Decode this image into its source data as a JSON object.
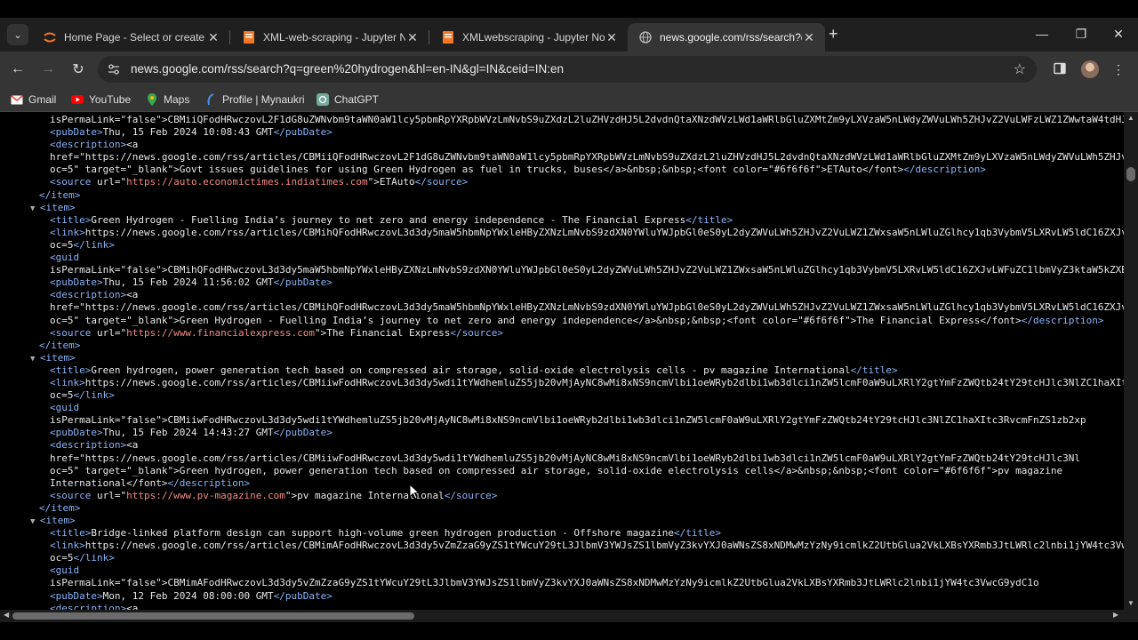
{
  "tabs": [
    {
      "title": "Home Page - Select or create a",
      "favicon": "jupyter-icon",
      "active": false
    },
    {
      "title": "XML-web-scraping - Jupyter Nc",
      "favicon": "jupyter-notebook-icon",
      "active": false
    },
    {
      "title": "XMLwebscraping - Jupyter Note",
      "favicon": "jupyter-notebook-icon",
      "active": false
    },
    {
      "title": "news.google.com/rss/search?q",
      "favicon": "globe-icon",
      "active": true
    }
  ],
  "address": {
    "url": "news.google.com/rss/search?q=green%20hydrogen&hl=en-IN&gl=IN&ceid=IN:en"
  },
  "bookmarks": [
    {
      "label": "Gmail",
      "icon": "gmail-icon"
    },
    {
      "label": "YouTube",
      "icon": "youtube-icon"
    },
    {
      "label": "Maps",
      "icon": "maps-icon"
    },
    {
      "label": "Profile | Mynaukri",
      "icon": "naukri-icon"
    },
    {
      "label": "ChatGPT",
      "icon": "chatgpt-icon"
    }
  ],
  "colors": {
    "tag": "#8ab4f8",
    "attr_value": "#f28b82",
    "text": "#e8e8e8",
    "background": "#000000"
  },
  "xml_lines": [
    {
      "indent": 2,
      "parts": [
        [
          "t",
          "isPermaLink=\"false\">CBMiiQFodHRwczovL2F1dG8uZWNvbm9taWN0aW1lcy5pbmRpYXRpbWVzLmNvbS9uZXdzL2luZHVzdHJ5L2dvdnQtaXNzdWVzLWd1aWRlbGluZXMtZm9yLXVzaW5nLWdyZWVuLWh5ZHJvZ2VuLWFzLWZ1ZWwtaW4tdHJ1Y2tz"
        ]
      ]
    },
    {
      "indent": 2,
      "parts": [
        [
          "g",
          "<pubDate>"
        ],
        [
          "t",
          "Thu, 15 Feb 2024 10:08:43 GMT"
        ],
        [
          "g",
          "</pubDate>"
        ]
      ]
    },
    {
      "indent": 2,
      "parts": [
        [
          "g",
          "<description>"
        ],
        [
          "t",
          "<a"
        ]
      ]
    },
    {
      "indent": 2,
      "parts": [
        [
          "t",
          "href=\"https://news.google.com/rss/articles/CBMiiQFodHRwczovL2F1dG8uZWNvbm9taWN0aW1lcy5pbmRpYXRpbWVzLmNvbS9uZXdzL2luZHVzdHJ5L2dvdnQtaXNzdWVzLWd1aWRlbGluZXMtZm9yLXVzaW5nLWdyZWVuLWh5ZHJv"
        ]
      ]
    },
    {
      "indent": 2,
      "parts": [
        [
          "t",
          "oc=5\" target=\"_blank\">Govt issues guidelines for using Green Hydrogen as fuel in trucks, buses</a>&nbsp;&nbsp;<font color=\"#6f6f6f\">ETAuto</font>"
        ],
        [
          "g",
          "</description>"
        ]
      ]
    },
    {
      "indent": 2,
      "parts": [
        [
          "g",
          "<source "
        ],
        [
          "t",
          "url=\""
        ],
        [
          "v",
          "https://auto.economictimes.indiatimes.com"
        ],
        [
          "t",
          "\">"
        ],
        [
          "t",
          "ETAuto"
        ],
        [
          "g",
          "</source>"
        ]
      ]
    },
    {
      "indent": 1,
      "parts": [
        [
          "g",
          "</item>"
        ]
      ]
    },
    {
      "indent": 0,
      "tri": true,
      "parts": [
        [
          "g",
          "<item>"
        ]
      ]
    },
    {
      "indent": 2,
      "parts": [
        [
          "g",
          "<title>"
        ],
        [
          "t",
          "Green Hydrogen - Fuelling India’s journey to net zero and energy independence - The Financial Express"
        ],
        [
          "g",
          "</title>"
        ]
      ]
    },
    {
      "indent": 2,
      "parts": [
        [
          "g",
          "<link>"
        ],
        [
          "t",
          "https://news.google.com/rss/articles/CBMihQFodHRwczovL3d3dy5maW5hbmNpYWxleHByZXNzLmNvbS9zdXN0YWluYWJpbGl0eS0yL2dyZWVuLWh5ZHJvZ2VuLWZ1ZWxsaW5nLWluZGlhcy1qb3VybmV5LXRvLW5ldC16ZXJvLWFuZC1lbmVyZ3kt"
        ]
      ]
    },
    {
      "indent": 2,
      "parts": [
        [
          "t",
          "oc=5"
        ],
        [
          "g",
          "</link>"
        ]
      ]
    },
    {
      "indent": 2,
      "parts": [
        [
          "g",
          "<guid"
        ]
      ]
    },
    {
      "indent": 2,
      "parts": [
        [
          "t",
          "isPermaLink=\"false\">CBMihQFodHRwczovL3d3dy5maW5hbmNpYWxleHByZXNzLmNvbS9zdXN0YWluYWJpbGl0eS0yL2dyZWVuLWh5ZHJvZ2VuLWZ1ZWxsaW5nLWluZGlhcy1qb3VybmV5LXRvLW5ldC16ZXJvLWFuZC1lbmVyZ3ktaW5kZXBl"
        ]
      ]
    },
    {
      "indent": 2,
      "parts": [
        [
          "g",
          "<pubDate>"
        ],
        [
          "t",
          "Thu, 15 Feb 2024 11:56:02 GMT"
        ],
        [
          "g",
          "</pubDate>"
        ]
      ]
    },
    {
      "indent": 2,
      "parts": [
        [
          "g",
          "<description>"
        ],
        [
          "t",
          "<a"
        ]
      ]
    },
    {
      "indent": 2,
      "parts": [
        [
          "t",
          "href=\"https://news.google.com/rss/articles/CBMihQFodHRwczovL3d3dy5maW5hbmNpYWxleHByZXNzLmNvbS9zdXN0YWluYWJpbGl0eS0yL2dyZWVuLWh5ZHJvZ2VuLWZ1ZWxsaW5nLWluZGlhcy1qb3VybmV5LXRvLW5ldC16ZXJv"
        ]
      ]
    },
    {
      "indent": 2,
      "parts": [
        [
          "t",
          "oc=5\" target=\"_blank\">Green Hydrogen - Fuelling India’s journey to net zero and energy independence</a>&nbsp;&nbsp;<font color=\"#6f6f6f\">The Financial Express</font>"
        ],
        [
          "g",
          "</description>"
        ]
      ]
    },
    {
      "indent": 2,
      "parts": [
        [
          "g",
          "<source "
        ],
        [
          "t",
          "url=\""
        ],
        [
          "v",
          "https://www.financialexpress.com"
        ],
        [
          "t",
          "\">"
        ],
        [
          "t",
          "The Financial Express"
        ],
        [
          "g",
          "</source>"
        ]
      ]
    },
    {
      "indent": 1,
      "parts": [
        [
          "g",
          "</item>"
        ]
      ]
    },
    {
      "indent": 0,
      "tri": true,
      "parts": [
        [
          "g",
          "<item>"
        ]
      ]
    },
    {
      "indent": 2,
      "parts": [
        [
          "g",
          "<title>"
        ],
        [
          "t",
          "Green hydrogen, power generation tech based on compressed air storage, solid-oxide electrolysis cells - pv magazine International"
        ],
        [
          "g",
          "</title>"
        ]
      ]
    },
    {
      "indent": 2,
      "parts": [
        [
          "g",
          "<link>"
        ],
        [
          "t",
          "https://news.google.com/rss/articles/CBMiiwFodHRwczovL3d3dy5wdi1tYWdhemluZS5jb20vMjAyNC8wMi8xNS9ncmVlbi1oeWRyb2dlbi1wb3dlci1nZW5lcmF0aW9uLXRlY2gtYmFzZWQtb24tY29tcHJlc3NlZC1haXIt"
        ]
      ]
    },
    {
      "indent": 2,
      "parts": [
        [
          "t",
          "oc=5"
        ],
        [
          "g",
          "</link>"
        ]
      ]
    },
    {
      "indent": 2,
      "parts": [
        [
          "g",
          "<guid"
        ]
      ]
    },
    {
      "indent": 2,
      "parts": [
        [
          "t",
          "isPermaLink=\"false\">CBMiiwFodHRwczovL3d3dy5wdi1tYWdhemluZS5jb20vMjAyNC8wMi8xNS9ncmVlbi1oeWRyb2dlbi1wb3dlci1nZW5lcmF0aW9uLXRlY2gtYmFzZWQtb24tY29tcHJlc3NlZC1haXItc3RvcmFnZS1zb2xp"
        ]
      ]
    },
    {
      "indent": 2,
      "parts": [
        [
          "g",
          "<pubDate>"
        ],
        [
          "t",
          "Thu, 15 Feb 2024 14:43:27 GMT"
        ],
        [
          "g",
          "</pubDate>"
        ]
      ]
    },
    {
      "indent": 2,
      "parts": [
        [
          "g",
          "<description>"
        ],
        [
          "t",
          "<a"
        ]
      ]
    },
    {
      "indent": 2,
      "parts": [
        [
          "t",
          "href=\"https://news.google.com/rss/articles/CBMiiwFodHRwczovL3d3dy5wdi1tYWdhemluZS5jb20vMjAyNC8wMi8xNS9ncmVlbi1oeWRyb2dlbi1wb3dlci1nZW5lcmF0aW9uLXRlY2gtYmFzZWQtb24tY29tcHJlc3Nl"
        ]
      ]
    },
    {
      "indent": 2,
      "parts": [
        [
          "t",
          "oc=5\" target=\"_blank\">Green hydrogen, power generation tech based on compressed air storage, solid-oxide electrolysis cells</a>&nbsp;&nbsp;<font color=\"#6f6f6f\">pv magazine"
        ]
      ]
    },
    {
      "indent": 2,
      "parts": [
        [
          "t",
          "International</font>"
        ],
        [
          "g",
          "</description>"
        ]
      ]
    },
    {
      "indent": 2,
      "parts": [
        [
          "g",
          "<source "
        ],
        [
          "t",
          "url=\""
        ],
        [
          "v",
          "https://www.pv-magazine.com"
        ],
        [
          "t",
          "\">"
        ],
        [
          "t",
          "pv magazine International"
        ],
        [
          "g",
          "</source>"
        ]
      ]
    },
    {
      "indent": 1,
      "parts": [
        [
          "g",
          "</item>"
        ]
      ]
    },
    {
      "indent": 0,
      "tri": true,
      "parts": [
        [
          "g",
          "<item>"
        ]
      ]
    },
    {
      "indent": 2,
      "parts": [
        [
          "g",
          "<title>"
        ],
        [
          "t",
          "Bridge-linked platform design can support high-volume green hydrogen production - Offshore magazine"
        ],
        [
          "g",
          "</title>"
        ]
      ]
    },
    {
      "indent": 2,
      "parts": [
        [
          "g",
          "<link>"
        ],
        [
          "t",
          "https://news.google.com/rss/articles/CBMimAFodHRwczovL3d3dy5vZmZzaG9yZS1tYWcuY29tL3JlbmV3YWJsZS1lbmVyZ3kvYXJ0aWNsZS8xNDMwMzYzNy9icmlkZ2UtbGlua2VkLXBsYXRmb3JtLWRlc2lnbi1jYW4tc3Vw"
        ]
      ]
    },
    {
      "indent": 2,
      "parts": [
        [
          "t",
          "oc=5"
        ],
        [
          "g",
          "</link>"
        ]
      ]
    },
    {
      "indent": 2,
      "parts": [
        [
          "g",
          "<guid"
        ]
      ]
    },
    {
      "indent": 2,
      "parts": [
        [
          "t",
          "isPermaLink=\"false\">CBMimAFodHRwczovL3d3dy5vZmZzaG9yZS1tYWcuY29tL3JlbmV3YWJsZS1lbmVyZ3kvYXJ0aWNsZS8xNDMwMzYzNy9icmlkZ2UtbGlua2VkLXBsYXRmb3JtLWRlc2lnbi1jYW4tc3VwcG9ydC1o"
        ]
      ]
    },
    {
      "indent": 2,
      "parts": [
        [
          "g",
          "<pubDate>"
        ],
        [
          "t",
          "Mon, 12 Feb 2024 08:00:00 GMT"
        ],
        [
          "g",
          "</pubDate>"
        ]
      ]
    },
    {
      "indent": 2,
      "parts": [
        [
          "g",
          "<description>"
        ],
        [
          "t",
          "<a"
        ]
      ]
    }
  ]
}
